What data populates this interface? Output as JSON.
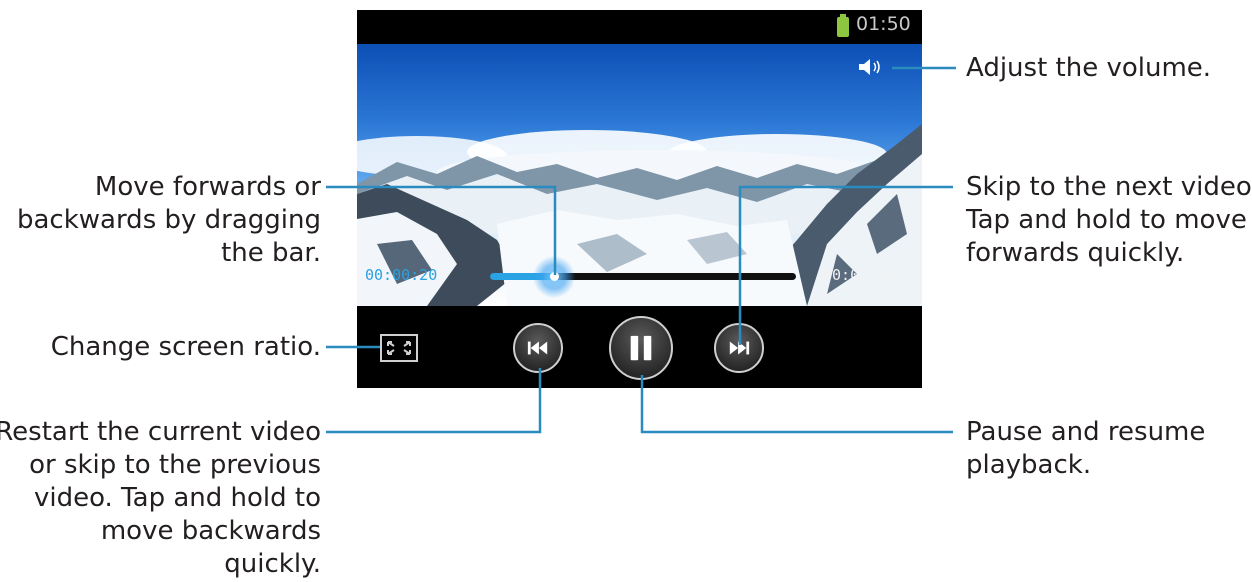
{
  "player": {
    "clock": "01:50",
    "time_elapsed": "00:00:20",
    "time_total": "00:01:36",
    "progress_fraction": 0.21,
    "icons": {
      "battery": "battery-icon",
      "volume": "volume-icon",
      "screen_ratio": "screen-ratio-icon",
      "previous": "rewind-icon",
      "pause": "pause-icon",
      "next": "fast-forward-icon"
    },
    "colors": {
      "accent": "#29a3e3",
      "battery": "#8dc63f",
      "callout_line": "#2a8bbf"
    }
  },
  "callouts": {
    "volume": [
      "Adjust the volume."
    ],
    "seek": [
      "Move forwards or",
      "backwards by dragging",
      "the bar."
    ],
    "next": [
      "Skip to the next video.",
      "Tap and hold to move",
      "forwards quickly."
    ],
    "ratio": [
      "Change screen ratio."
    ],
    "previous": [
      "Restart the current video",
      "or skip to the previous",
      "video. Tap and hold to",
      "move backwards",
      "quickly."
    ],
    "pause": [
      "Pause and resume",
      "playback."
    ]
  }
}
